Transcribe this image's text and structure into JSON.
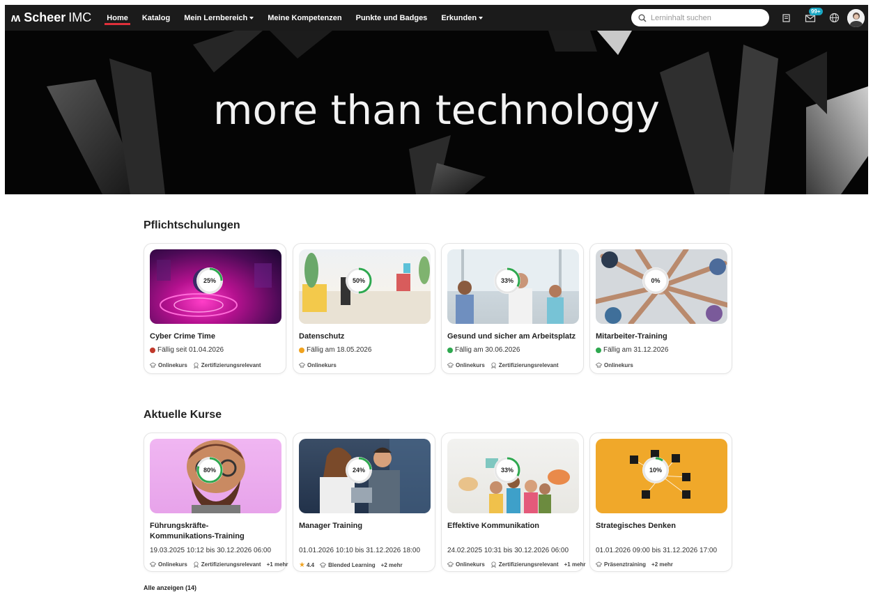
{
  "nav": {
    "logo_mark": "ʍ",
    "brand_bold": "Scheer",
    "brand_light": "IMC",
    "items": [
      {
        "label": "Home",
        "active": true
      },
      {
        "label": "Katalog"
      },
      {
        "label": "Mein Lernbereich",
        "dropdown": true
      },
      {
        "label": "Meine Kompetenzen"
      },
      {
        "label": "Punkte und Badges"
      },
      {
        "label": "Erkunden",
        "dropdown": true
      }
    ],
    "search_placeholder": "Lerninhalt suchen",
    "icons": [
      "search-icon",
      "book-icon",
      "mail-icon",
      "globe-icon",
      "avatar"
    ],
    "mail_badge": "99+",
    "accent": "#e0303a"
  },
  "hero": {
    "headline": "more than technology"
  },
  "sections": {
    "mandatory": {
      "title": "Pflichtschulungen",
      "cards": [
        {
          "title": "Cyber Crime Time",
          "progress": 25,
          "status": "Fällig seit 01.04.2026",
          "status_color": "#c0392b",
          "tags": [
            "Onlinekurs",
            "Zertifizierungsrelevant"
          ]
        },
        {
          "title": "Datenschutz",
          "progress": 50,
          "status": "Fällig am 18.05.2026",
          "status_color": "#f0a21e",
          "tags": [
            "Onlinekurs"
          ]
        },
        {
          "title": "Gesund und sicher am Arbeitsplatz",
          "progress": 33,
          "status": "Fällig am 30.06.2026",
          "status_color": "#2ea84f",
          "tags": [
            "Onlinekurs",
            "Zertifizierungsrelevant"
          ]
        },
        {
          "title": "Mitarbeiter-Training",
          "progress": 0,
          "status": "Fällig am 31.12.2026",
          "status_color": "#2ea84f",
          "tags": [
            "Onlinekurs"
          ]
        }
      ]
    },
    "current": {
      "title": "Aktuelle Kurse",
      "cards": [
        {
          "title": "Führungskräfte-Kommunikations-Training",
          "progress": 80,
          "date": "19.03.2025 10:12 bis 30.12.2026 06:00",
          "tags": [
            "Onlinekurs",
            "Zertifizierungsrelevant"
          ],
          "more": "+1 mehr"
        },
        {
          "title": "Manager Training",
          "progress": 24,
          "date": "01.01.2026 10:10 bis 31.12.2026 18:00",
          "rating": "4.4",
          "tags": [
            "Blended Learning"
          ],
          "more": "+2 mehr"
        },
        {
          "title": "Effektive Kommunikation",
          "progress": 33,
          "date": "24.02.2025 10:31 bis 30.12.2026 06:00",
          "tags": [
            "Onlinekurs",
            "Zertifizierungsrelevant"
          ],
          "more": "+1 mehr"
        },
        {
          "title": "Strategisches Denken",
          "progress": 10,
          "date": "01.01.2026 09:00 bis 31.12.2026 17:00",
          "tags": [
            "Präsenztraining"
          ],
          "more": "+2 mehr"
        }
      ],
      "show_all": "Alle anzeigen (14)"
    }
  },
  "colors": {
    "progress_ring": "#2ea84f",
    "progress_track": "#e6e6e6"
  }
}
